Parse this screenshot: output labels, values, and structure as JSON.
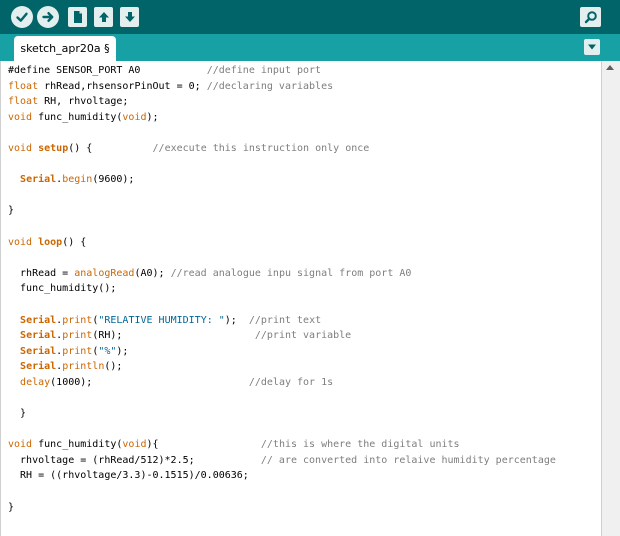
{
  "toolbar": {
    "buttons": [
      {
        "name": "verify-button",
        "icon": "check-icon"
      },
      {
        "name": "upload-button",
        "icon": "arrow-right-icon"
      },
      {
        "name": "new-button",
        "icon": "new-file-icon"
      },
      {
        "name": "open-button",
        "icon": "arrow-up-icon"
      },
      {
        "name": "save-button",
        "icon": "arrow-down-icon"
      }
    ],
    "serial_monitor_icon": "magnifier-icon"
  },
  "tabs": {
    "active_tab_label": "sketch_apr20a §",
    "menu_icon": "chevron-down-icon"
  },
  "colors": {
    "toolbar_bg": "#006468",
    "tabbar_bg": "#17a1a5",
    "keyword": "#cc6600",
    "string": "#006699",
    "comment": "#7e7e7e"
  },
  "code_lines": [
    [
      {
        "t": "#define SENSOR_PORT A0           "
      },
      {
        "t": "//define input port",
        "c": "cm"
      }
    ],
    [
      {
        "t": "float",
        "c": "kw"
      },
      {
        "t": " rhRead,rhsensorPinOut = 0; "
      },
      {
        "t": "//declaring variables",
        "c": "cm"
      }
    ],
    [
      {
        "t": "float",
        "c": "kw"
      },
      {
        "t": " RH, rhvoltage;"
      }
    ],
    [
      {
        "t": "void",
        "c": "kw"
      },
      {
        "t": " func_humidity("
      },
      {
        "t": "void",
        "c": "kw"
      },
      {
        "t": ");"
      }
    ],
    [
      {
        "t": ""
      }
    ],
    [
      {
        "t": "void",
        "c": "kw"
      },
      {
        "t": " "
      },
      {
        "t": "setup",
        "c": "fnb"
      },
      {
        "t": "() {          "
      },
      {
        "t": "//execute this instruction only once",
        "c": "cm"
      }
    ],
    [
      {
        "t": ""
      }
    ],
    [
      {
        "t": "  "
      },
      {
        "t": "Serial",
        "c": "kwb"
      },
      {
        "t": "."
      },
      {
        "t": "begin",
        "c": "kw"
      },
      {
        "t": "(9600);"
      }
    ],
    [
      {
        "t": ""
      }
    ],
    [
      {
        "t": "}"
      }
    ],
    [
      {
        "t": ""
      }
    ],
    [
      {
        "t": "void",
        "c": "kw"
      },
      {
        "t": " "
      },
      {
        "t": "loop",
        "c": "fnb"
      },
      {
        "t": "() {"
      }
    ],
    [
      {
        "t": ""
      }
    ],
    [
      {
        "t": "  rhRead = "
      },
      {
        "t": "analogRead",
        "c": "kw"
      },
      {
        "t": "(A0); "
      },
      {
        "t": "//read analogue inpu signal from port A0",
        "c": "cm"
      }
    ],
    [
      {
        "t": "  func_humidity();"
      }
    ],
    [
      {
        "t": ""
      }
    ],
    [
      {
        "t": "  "
      },
      {
        "t": "Serial",
        "c": "kwb"
      },
      {
        "t": "."
      },
      {
        "t": "print",
        "c": "kw"
      },
      {
        "t": "("
      },
      {
        "t": "\"RELATIVE HUMIDITY: \"",
        "c": "str"
      },
      {
        "t": ");  "
      },
      {
        "t": "//print text",
        "c": "cm"
      }
    ],
    [
      {
        "t": "  "
      },
      {
        "t": "Serial",
        "c": "kwb"
      },
      {
        "t": "."
      },
      {
        "t": "print",
        "c": "kw"
      },
      {
        "t": "(RH);                      "
      },
      {
        "t": "//print variable",
        "c": "cm"
      }
    ],
    [
      {
        "t": "  "
      },
      {
        "t": "Serial",
        "c": "kwb"
      },
      {
        "t": "."
      },
      {
        "t": "print",
        "c": "kw"
      },
      {
        "t": "("
      },
      {
        "t": "\"%\"",
        "c": "str"
      },
      {
        "t": ");"
      }
    ],
    [
      {
        "t": "  "
      },
      {
        "t": "Serial",
        "c": "kwb"
      },
      {
        "t": "."
      },
      {
        "t": "println",
        "c": "kw"
      },
      {
        "t": "();"
      }
    ],
    [
      {
        "t": "  "
      },
      {
        "t": "delay",
        "c": "kw"
      },
      {
        "t": "(1000);                          "
      },
      {
        "t": "//delay for 1s",
        "c": "cm"
      }
    ],
    [
      {
        "t": ""
      }
    ],
    [
      {
        "t": "  }"
      }
    ],
    [
      {
        "t": ""
      }
    ],
    [
      {
        "t": "void",
        "c": "kw"
      },
      {
        "t": " func_humidity("
      },
      {
        "t": "void",
        "c": "kw"
      },
      {
        "t": "){                 "
      },
      {
        "t": "//this is where the digital units",
        "c": "cm"
      }
    ],
    [
      {
        "t": "  rhvoltage = (rhRead/512)*2.5;           "
      },
      {
        "t": "// are converted into relaive humidity percentage",
        "c": "cm"
      }
    ],
    [
      {
        "t": "  RH = ((rhvoltage/3.3)-0.1515)/0.00636;"
      }
    ],
    [
      {
        "t": ""
      }
    ],
    [
      {
        "t": "}"
      }
    ]
  ]
}
